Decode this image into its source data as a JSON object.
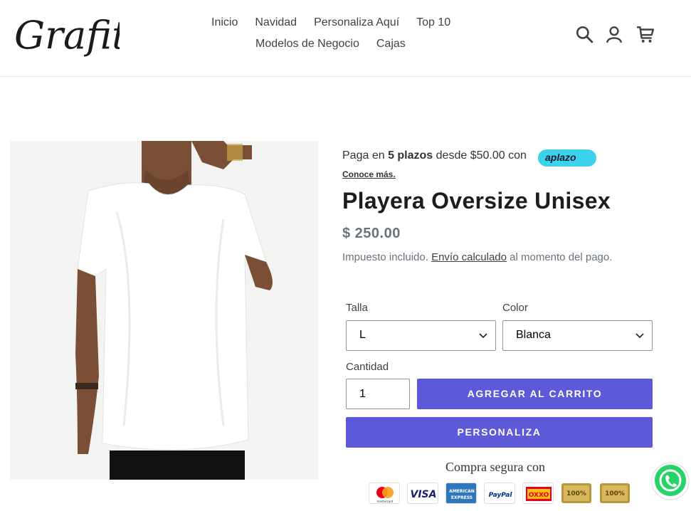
{
  "brand": {
    "logo_text": "Grafitty"
  },
  "nav": {
    "row1": [
      "Inicio",
      "Navidad",
      "Personaliza Aquí",
      "Top 10"
    ],
    "row2": [
      "Modelos de Negocio",
      "Cajas"
    ]
  },
  "header_icons": [
    "search-icon",
    "account-icon",
    "cart-icon"
  ],
  "aplazo": {
    "prefix": "Paga en ",
    "bold": "5 plazos",
    "suffix": " desde $50.00 con",
    "badge": "aplazo",
    "learn_more": "Conoce más."
  },
  "product": {
    "title": "Playera Oversize Unisex",
    "price": "$ 250.00",
    "tax_prefix": "Impuesto incluido. ",
    "tax_link": "Envío calculado",
    "tax_suffix": " al momento del pago."
  },
  "options": {
    "size_label": "Talla",
    "size_value": "L",
    "color_label": "Color",
    "color_value": "Blanca",
    "qty_label": "Cantidad",
    "qty_value": "1"
  },
  "buttons": {
    "add_to_cart": "AGREGAR AL CARRITO",
    "personalize": "PERSONALIZA"
  },
  "secure": {
    "label": "Compra segura con",
    "methods": [
      "mastercard",
      "VISA",
      "AMERICAN EXPRESS",
      "PayPal",
      "OXXO",
      "100%",
      "100%"
    ]
  },
  "colors": {
    "accent": "#5c5ad9",
    "aplazo": "#3cd2eb",
    "whatsapp": "#25d366"
  }
}
